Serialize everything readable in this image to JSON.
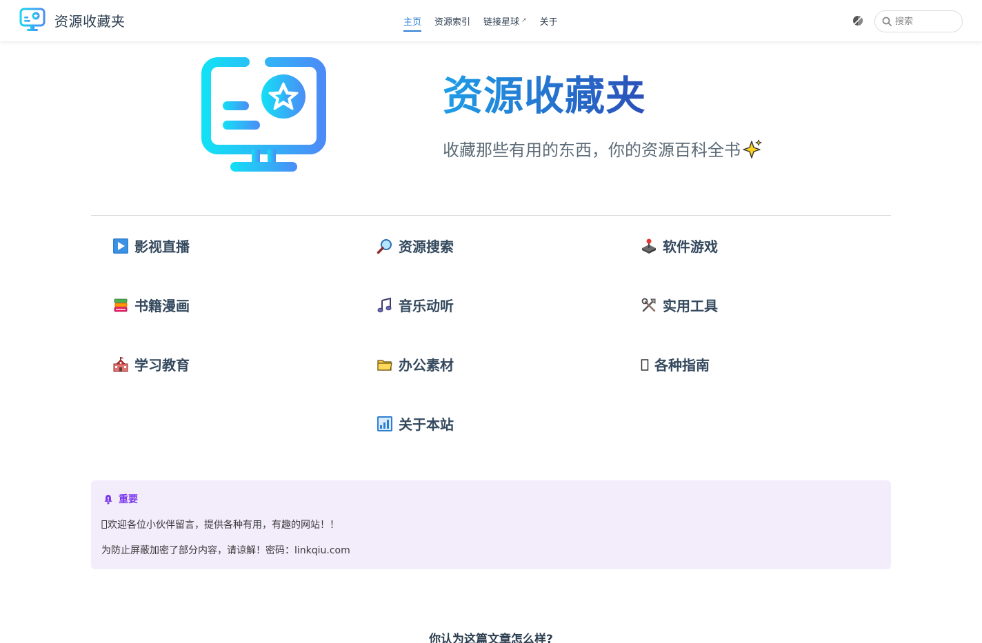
{
  "brand": {
    "title": "资源收藏夹"
  },
  "nav": {
    "items": [
      {
        "label": "主页",
        "active": true
      },
      {
        "label": "资源索引"
      },
      {
        "label": "链接星球",
        "external": true
      },
      {
        "label": "关于"
      }
    ],
    "external_mark": "↗"
  },
  "search": {
    "placeholder": "搜索"
  },
  "hero": {
    "title": "资源收藏夹",
    "tagline": "收藏那些有用的东西，你的资源百科全书"
  },
  "features": [
    {
      "label": "影视直播",
      "icon": "play-button-icon"
    },
    {
      "label": "资源搜索",
      "icon": "magnifier-icon"
    },
    {
      "label": "软件游戏",
      "icon": "joystick-icon"
    },
    {
      "label": "书籍漫画",
      "icon": "books-icon"
    },
    {
      "label": "音乐动听",
      "icon": "music-note-icon"
    },
    {
      "label": "实用工具",
      "icon": "tools-icon"
    },
    {
      "label": "学习教育",
      "icon": "school-icon"
    },
    {
      "label": "办公素材",
      "icon": "folder-icon"
    },
    {
      "label": "各种指南",
      "icon": "missing-glyph-icon"
    },
    {
      "label": "关于本站",
      "icon": "bar-chart-icon"
    }
  ],
  "notice": {
    "title": "重要",
    "lines": [
      "欢迎各位小伙伴留言，提供各种有用，有趣的网站！！",
      "为防止屏蔽加密了部分内容，请谅解！密码：linkqiu.com"
    ]
  },
  "feedback": {
    "question": "你认为这篇文章怎么样?"
  },
  "colors": {
    "accent": "#2e7fd6",
    "title_gradient_start": "#1e9ee8",
    "title_gradient_end": "#2b4fb8",
    "notice_bg": "#f2ecfb",
    "notice_title": "#7c3aed"
  }
}
